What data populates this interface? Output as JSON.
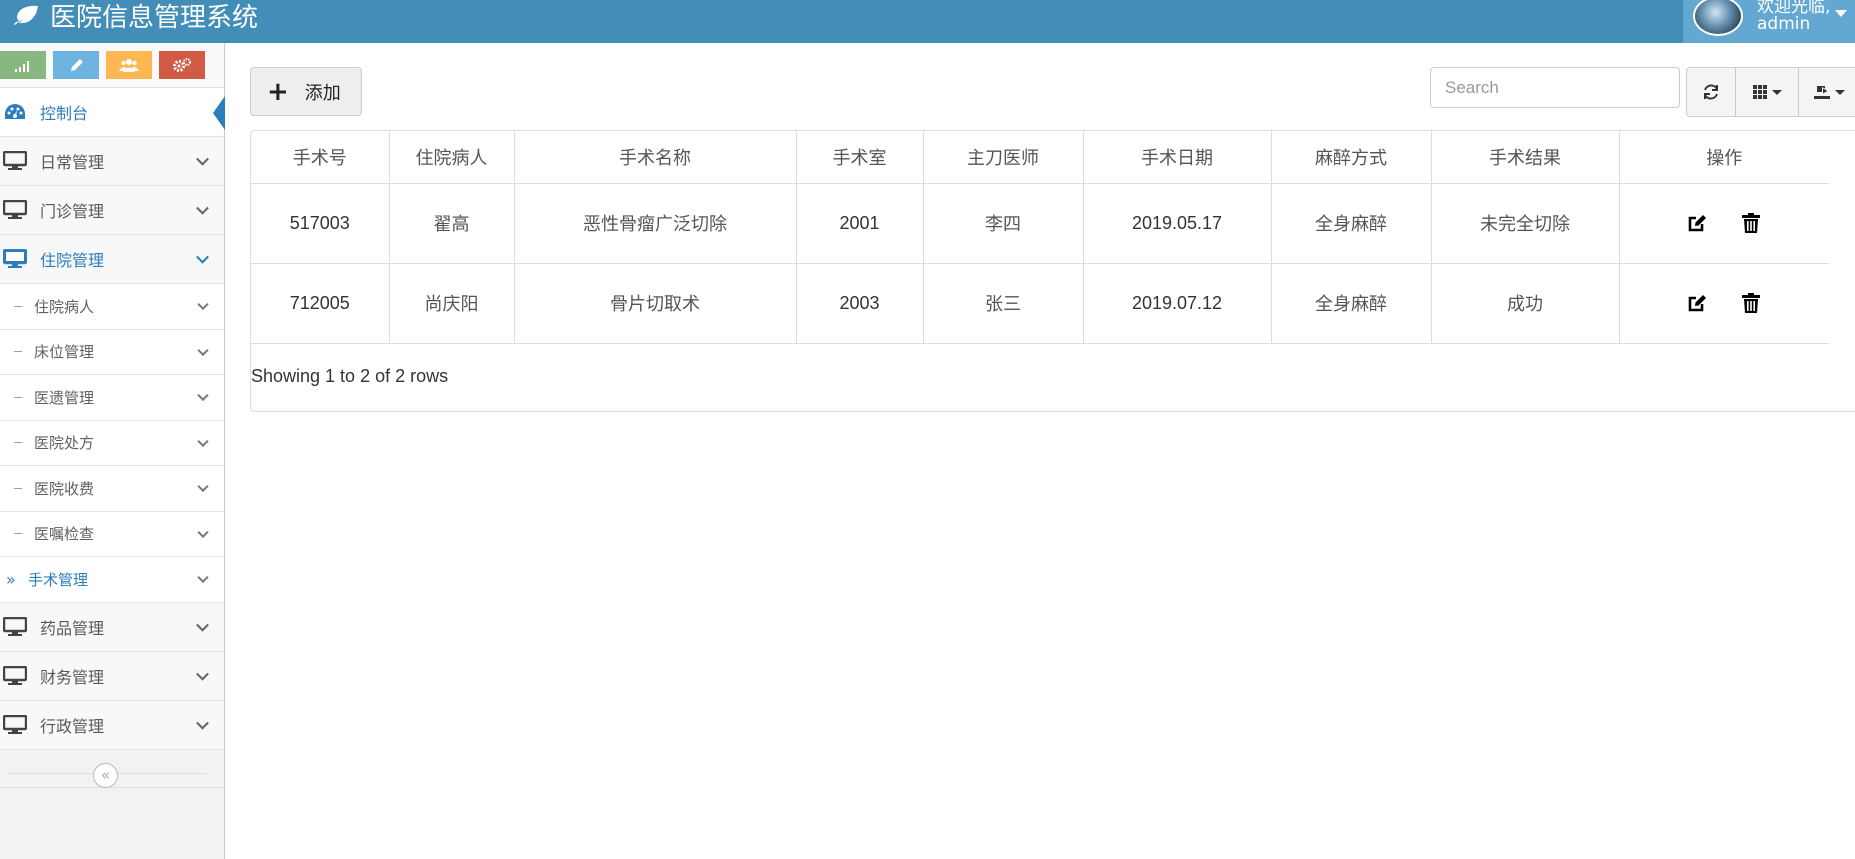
{
  "app": {
    "title": "医院信息管理系统"
  },
  "user": {
    "greeting": "欢迎光临,",
    "name": "admin"
  },
  "shortcuts": [
    {
      "icon": "signal-icon",
      "color": "#87b87f"
    },
    {
      "icon": "pencil-icon",
      "color": "#6fb3e0"
    },
    {
      "icon": "users-icon",
      "color": "#ffb752"
    },
    {
      "icon": "cogs-icon",
      "color": "#d15b47"
    }
  ],
  "sidebar": {
    "dashboard": "控制台",
    "daily": "日常管理",
    "outpatient": "门诊管理",
    "inpatient": "住院管理",
    "sub": {
      "patients": "住院病人",
      "beds": "床位管理",
      "wills": "医遗管理",
      "prescriptions": "医院处方",
      "billing": "医院收费",
      "orders": "医嘱检查",
      "surgery": "手术管理"
    },
    "pharmacy": "药品管理",
    "finance": "财务管理",
    "admin": "行政管理",
    "collapse_glyph": "«"
  },
  "toolbar": {
    "add_label": "添加",
    "search_placeholder": "Search"
  },
  "table": {
    "headers": [
      "手术号",
      "住院病人",
      "手术名称",
      "手术室",
      "主刀医师",
      "手术日期",
      "麻醉方式",
      "手术结果",
      "操作"
    ],
    "rows": [
      [
        "517003",
        "翟高",
        "恶性骨瘤广泛切除",
        "2001",
        "李四",
        "2019.05.17",
        "全身麻醉",
        "未完全切除"
      ],
      [
        "712005",
        "尚庆阳",
        "骨片切取术",
        "2003",
        "张三",
        "2019.07.12",
        "全身麻醉",
        "成功"
      ]
    ]
  },
  "pagination": {
    "info": "Showing 1 to 2 of 2 rows"
  }
}
